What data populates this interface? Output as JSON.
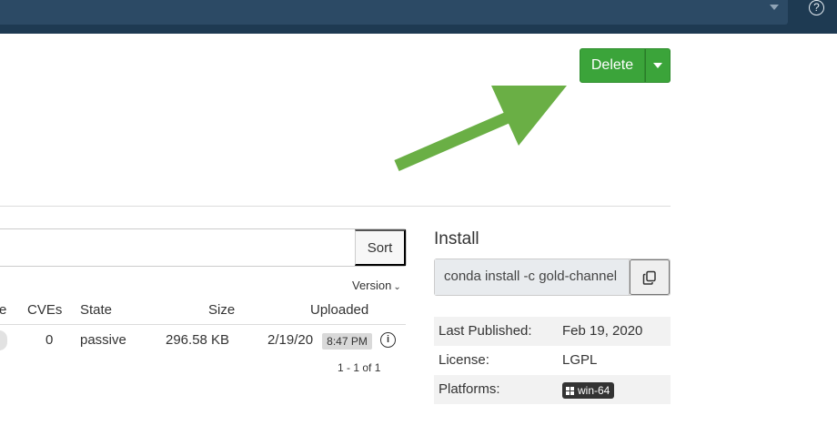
{
  "topbar": {
    "help_glyph": "?"
  },
  "actions": {
    "delete_label": "Delete"
  },
  "files": {
    "sort_label": "Sort",
    "version_sort_label": "Version",
    "columns": {
      "partial": "e",
      "cves": "CVEs",
      "state": "State",
      "size": "Size",
      "uploaded": "Uploaded"
    },
    "rows": [
      {
        "cves": "0",
        "state": "passive",
        "size": "296.58 KB",
        "date": "2/19/20",
        "time": "8:47 PM"
      }
    ],
    "pagination": "1 - 1 of 1"
  },
  "install": {
    "title": "Install",
    "command": "conda install -c gold-channel"
  },
  "meta": {
    "last_published_label": "Last Published:",
    "last_published_value": "Feb 19, 2020",
    "license_label": "License:",
    "license_value": "LGPL",
    "platforms_label": "Platforms:",
    "platforms": [
      "win-64"
    ]
  },
  "colors": {
    "accent_green": "#3ba43a",
    "arrow_green": "#6aaf45",
    "topbar": "#1e3a52"
  },
  "icons": [
    "chevron-down-icon",
    "help-icon",
    "copy-icon",
    "info-icon",
    "windows-icon",
    "arrow-pointer-icon"
  ]
}
